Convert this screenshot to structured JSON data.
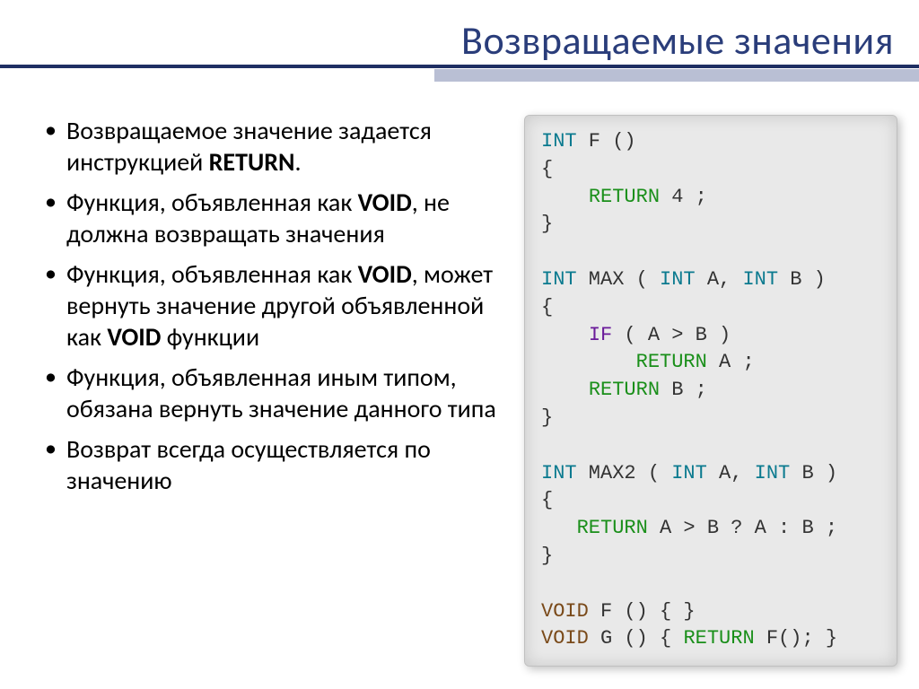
{
  "title": "Возвращаемые значения",
  "bullets": {
    "b1_pre": "Возвращаемое значение задается инструкцией ",
    "b1_bold": "RETURN",
    "b1_post": ".",
    "b2_pre": "Функция, объявленная как ",
    "b2_bold": "VOID",
    "b2_post": ", не должна возвращать значения",
    "b3_pre": "Функция, объявленная как ",
    "b3_bold1": "VOID",
    "b3_mid": ", может вернуть значение другой объявленной как ",
    "b3_bold2": "VOID",
    "b3_post": " функции",
    "b4": "Функция, объявленная иным типом, обязана вернуть значение данного типа",
    "b5": "Возврат всегда осуществляется по значению"
  },
  "code": {
    "t01": "INT",
    "t02": " F ()",
    "t03": "{",
    "t04": "    ",
    "t05": "RETURN",
    "t06": " 4 ;",
    "t07": "}",
    "t08": "",
    "t09": "INT",
    "t10": " MAX ( ",
    "t11": "INT",
    "t12": " A, ",
    "t13": "INT",
    "t14": " B )",
    "t15": "{",
    "t16": "    ",
    "t17": "IF",
    "t18": " ( A > B )",
    "t19": "        ",
    "t20": "RETURN",
    "t21": " A ;",
    "t22": "    ",
    "t23": "RETURN",
    "t24": " B ;",
    "t25": "}",
    "t26": "",
    "t27": "INT",
    "t28": " MAX2 ( ",
    "t29": "INT",
    "t30": " A, ",
    "t31": "INT",
    "t32": " B )",
    "t33": "{",
    "t34": "   ",
    "t35": "RETURN",
    "t36": " A > B ? A : B ;",
    "t37": "}",
    "t38": "",
    "t39": "VOID",
    "t40": " F () { }",
    "t41": "VOID",
    "t42": " G () { ",
    "t43": "RETURN",
    "t44": " F(); }"
  }
}
